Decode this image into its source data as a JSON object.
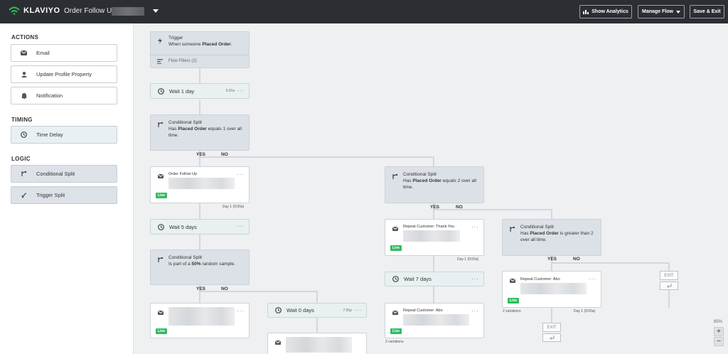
{
  "topbar": {
    "logo_text": "KLAVIYO",
    "flow_title": "Order Follow Up -",
    "show_analytics": "Show Analytics",
    "manage_flow": "Manage Flow",
    "save_exit": "Save & Exit"
  },
  "sidebar": {
    "actions_title": "ACTIONS",
    "actions": [
      {
        "label": "Email"
      },
      {
        "label": "Update Profile Property"
      },
      {
        "label": "Notification"
      }
    ],
    "timing_title": "TIMING",
    "timing": [
      {
        "label": "Time Delay"
      }
    ],
    "logic_title": "LOGIC",
    "logic": [
      {
        "label": "Conditional Split"
      },
      {
        "label": "Trigger Split"
      }
    ]
  },
  "flow": {
    "trigger": {
      "label": "Trigger",
      "text_pre": "When someone ",
      "text_bold": "Placed Order",
      "text_post": ".",
      "filters": "Flow Filters (2)"
    },
    "wait1": {
      "label": "Wait 1 day",
      "time": "9:00a"
    },
    "split1": {
      "label": "Conditional Split",
      "line1_pre": "Has ",
      "line1_bold": "Placed Order",
      "line1_post": " equals 1 over all",
      "line2": "time."
    },
    "email1": {
      "label": "Order Follow Up",
      "live": "Live",
      "day": "Day 1 (9:00a)"
    },
    "wait5": {
      "label": "Wait 5 days"
    },
    "split_random": {
      "label": "Conditional Split",
      "line1_pre": "Is part of a ",
      "line1_bold": "50%",
      "line1_post": " random sample."
    },
    "email_b": {
      "live": "Live"
    },
    "wait0": {
      "label": "Wait 0 days",
      "time": "7:00p"
    },
    "split2": {
      "label": "Conditional Split",
      "line1_pre": "Has ",
      "line1_bold": "Placed Order",
      "line1_post": " equals 2 over all",
      "line2": "time."
    },
    "email_thank": {
      "label": "Repeat Customer: Thank You",
      "live": "Live",
      "day": "Day 1 (9:00a)"
    },
    "wait7": {
      "label": "Wait 7 days"
    },
    "email_abo": {
      "label": "Repeat Customer: Abo",
      "live": "Live",
      "variations": "2 variations"
    },
    "split3": {
      "label": "Conditional Split",
      "line1_pre": "Has ",
      "line1_bold": "Placed Order",
      "line1_post": " is greater than 2",
      "line2": "over all time."
    },
    "email_abo2": {
      "label": "Repeat Customer: Abo",
      "live": "Live",
      "variations": "2 variations",
      "day": "Day 1 (9:00a)"
    },
    "yes": "YES",
    "no": "NO",
    "exit": "EXIT",
    "zoom": "85%",
    "zoom_in": "+",
    "zoom_out": "−",
    "more": "···"
  }
}
